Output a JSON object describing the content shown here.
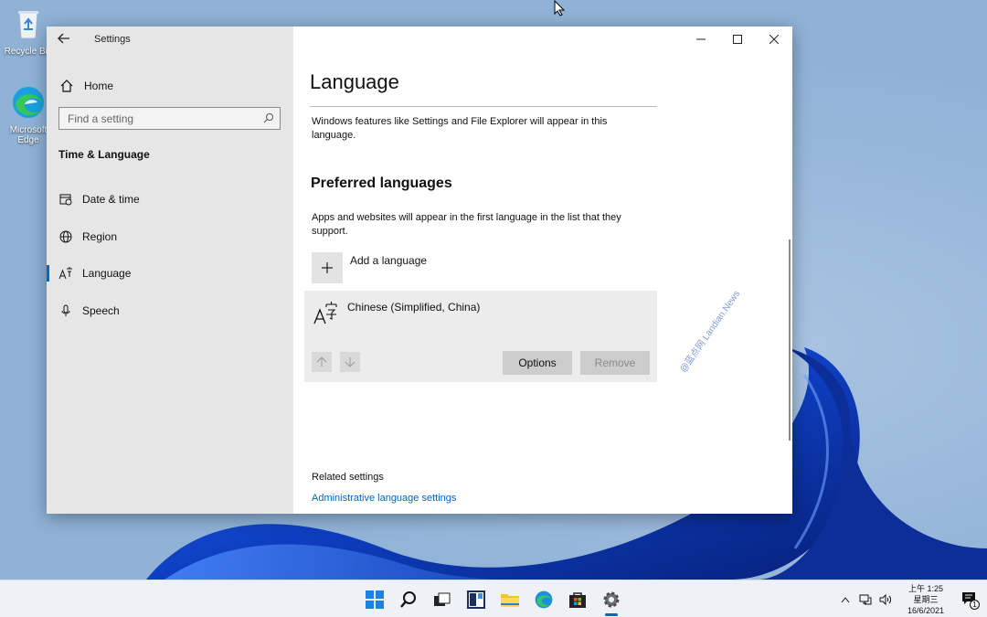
{
  "desktop": {
    "icons": [
      {
        "label": "Recycle Bin",
        "icon": "recycle-bin-icon"
      },
      {
        "label": "Microsoft Edge",
        "icon": "edge-icon"
      }
    ]
  },
  "window": {
    "title": "Settings",
    "controls": {
      "minimize": "minimize-icon",
      "maximize": "maximize-icon",
      "close": "close-icon"
    }
  },
  "nav": {
    "home_label": "Home",
    "search_placeholder": "Find a setting",
    "section_title": "Time & Language",
    "items": [
      {
        "label": "Date & time",
        "icon": "calendar-clock-icon",
        "active": false
      },
      {
        "label": "Region",
        "icon": "globe-icon",
        "active": false
      },
      {
        "label": "Language",
        "icon": "language-icon",
        "active": true
      },
      {
        "label": "Speech",
        "icon": "microphone-icon",
        "active": false
      }
    ]
  },
  "content": {
    "page_title": "Language",
    "display_desc": "Windows features like Settings and File Explorer will appear in this language.",
    "preferred_title": "Preferred languages",
    "preferred_desc": "Apps and websites will appear in the first language in the list that they support.",
    "add_language_label": "Add a language",
    "language_card": {
      "name": "Chinese (Simplified, China)",
      "options_label": "Options",
      "remove_label": "Remove"
    },
    "related_title": "Related settings",
    "related_link": "Administrative language settings",
    "watermark": "@蓝点网 Landian.News"
  },
  "taskbar": {
    "apps": [
      "start-icon",
      "search-icon",
      "task-view-icon",
      "widgets-icon",
      "file-explorer-icon",
      "edge-icon",
      "store-icon",
      "settings-icon"
    ],
    "clock": {
      "time": "上午 1:25",
      "weekday": "星期三",
      "date": "16/6/2021"
    },
    "notification_count": "1"
  },
  "colors": {
    "accent": "#0067c0",
    "nav_bg": "#e6e6e6",
    "card_bg": "#ececec",
    "taskbar_bg": "#eef1f5"
  }
}
